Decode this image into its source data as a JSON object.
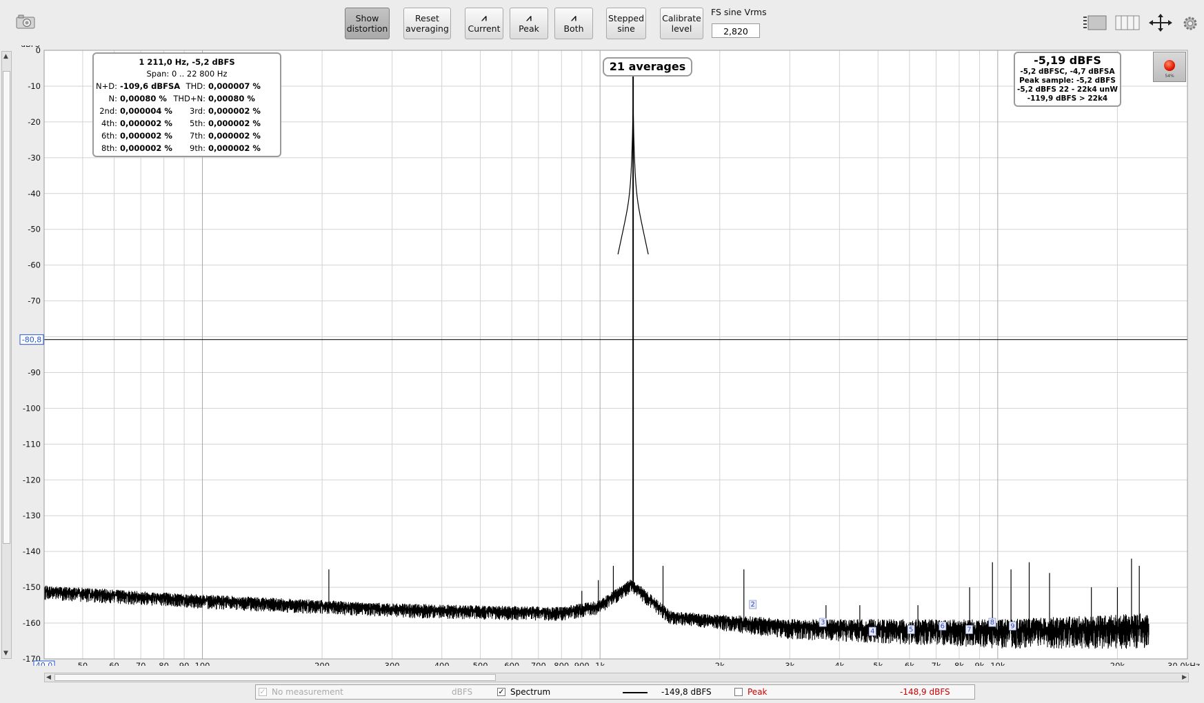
{
  "toolbar": {
    "show_distortion": "Show\ndistortion",
    "reset_averaging": "Reset\naveraging",
    "current": "Current",
    "peak": "Peak",
    "both": "Both",
    "stepped_sine": "Stepped\nsine",
    "calibrate_level": "Calibrate\nlevel",
    "fs_label": "FS sine Vrms",
    "fs_value": "2,820"
  },
  "icons": {
    "camera": "camera-icon",
    "layout": "layout-icon",
    "columns": "columns-icon",
    "move": "move-arrows-icon",
    "settings": "gear-icon",
    "record": "record-icon"
  },
  "distortion_box": {
    "line1": "1 211,0 Hz, -5,2 dBFS",
    "line2": "Span: 0 .. 22 800 Hz",
    "rows": [
      {
        "l_label": "N+D:",
        "l_val": "-109,6 dBFSA",
        "r_label": "THD:",
        "r_val": "0,000007 %"
      },
      {
        "l_label": "N:",
        "l_val": "0,00080 %",
        "r_label": "THD+N:",
        "r_val": "0,00080 %"
      },
      {
        "l_label": "2nd:",
        "l_val": "0,000004 %",
        "r_label": "3rd:",
        "r_val": "0,000002 %"
      },
      {
        "l_label": "4th:",
        "l_val": "0,000002 %",
        "r_label": "5th:",
        "r_val": "0,000002 %"
      },
      {
        "l_label": "6th:",
        "l_val": "0,000002 %",
        "r_label": "7th:",
        "r_val": "0,000002 %"
      },
      {
        "l_label": "8th:",
        "l_val": "0,000002 %",
        "r_label": "9th:",
        "r_val": "0,000002 %"
      }
    ]
  },
  "averages": "21 averages",
  "level_box": {
    "main": "-5,19 dBFS",
    "l1": "-5,2 dBFSC, -4,7 dBFSA",
    "l2": "Peak sample: -5,2 dBFS",
    "l3": "-5,2 dBFS 22 - 22k4 unW",
    "l4": "-119,9 dBFS > 22k4"
  },
  "record_meter": "54%",
  "legend": {
    "no_measurement": "No measurement",
    "dbfs": "dBFS",
    "spectrum": "Spectrum",
    "spectrum_value": "-149,8 dBFS",
    "peak": "Peak",
    "peak_value": "-148,9 dBFS"
  },
  "chart_data": {
    "type": "line",
    "ylabel": "dBFS",
    "xlabel": "",
    "x_scale": "log",
    "xlim": [
      40,
      30000
    ],
    "ylim": [
      -170,
      0
    ],
    "x_min_label": "40,0",
    "x_max_label": "30,0kHz",
    "x_ticks": [
      {
        "v": 50,
        "label": "50"
      },
      {
        "v": 60,
        "label": "60"
      },
      {
        "v": 70,
        "label": "70"
      },
      {
        "v": 80,
        "label": "80"
      },
      {
        "v": 90,
        "label": "90"
      },
      {
        "v": 100,
        "label": "100"
      },
      {
        "v": 200,
        "label": "200"
      },
      {
        "v": 300,
        "label": "300"
      },
      {
        "v": 400,
        "label": "400"
      },
      {
        "v": 500,
        "label": "500"
      },
      {
        "v": 600,
        "label": "600"
      },
      {
        "v": 700,
        "label": "700"
      },
      {
        "v": 800,
        "label": "800"
      },
      {
        "v": 900,
        "label": "900"
      },
      {
        "v": 1000,
        "label": "1k"
      },
      {
        "v": 2000,
        "label": "2k"
      },
      {
        "v": 3000,
        "label": "3k"
      },
      {
        "v": 4000,
        "label": "4k"
      },
      {
        "v": 5000,
        "label": "5k"
      },
      {
        "v": 6000,
        "label": "6k"
      },
      {
        "v": 7000,
        "label": "7k"
      },
      {
        "v": 8000,
        "label": "8k"
      },
      {
        "v": 9000,
        "label": "9k"
      },
      {
        "v": 10000,
        "label": "10k"
      },
      {
        "v": 20000,
        "label": "20k"
      }
    ],
    "y_ticks": [
      {
        "v": 0,
        "label": "0"
      },
      {
        "v": -10,
        "label": "-10"
      },
      {
        "v": -20,
        "label": "-20"
      },
      {
        "v": -30,
        "label": "-30"
      },
      {
        "v": -40,
        "label": "-40"
      },
      {
        "v": -50,
        "label": "-50"
      },
      {
        "v": -60,
        "label": "-60"
      },
      {
        "v": -70,
        "label": "-70"
      },
      {
        "v": -90,
        "label": "-90"
      },
      {
        "v": -100,
        "label": "-100"
      },
      {
        "v": -110,
        "label": "-110"
      },
      {
        "v": -120,
        "label": "-120"
      },
      {
        "v": -130,
        "label": "-130"
      },
      {
        "v": -140,
        "label": "-140"
      },
      {
        "v": -150,
        "label": "-150"
      },
      {
        "v": -160,
        "label": "-160"
      },
      {
        "v": -170,
        "label": "-170"
      }
    ],
    "cursor_level": -80.8,
    "cursor_label": "-80,8",
    "fundamental": {
      "freq": 1211,
      "level": -5.2
    },
    "noise_floor": [
      [
        40,
        -151
      ],
      [
        100,
        -153.5
      ],
      [
        300,
        -156
      ],
      [
        800,
        -157
      ],
      [
        1000,
        -155
      ],
      [
        1200,
        -149
      ],
      [
        1500,
        -158
      ],
      [
        3000,
        -161
      ],
      [
        10000,
        -162
      ],
      [
        24000,
        -161
      ]
    ],
    "spurs": [
      [
        208,
        -145
      ],
      [
        900,
        -151
      ],
      [
        990,
        -148
      ],
      [
        1080,
        -144
      ],
      [
        1440,
        -144
      ],
      [
        2300,
        -145
      ],
      [
        3700,
        -155
      ],
      [
        4500,
        -155
      ],
      [
        6300,
        -155
      ],
      [
        8500,
        -150
      ],
      [
        9700,
        -143
      ],
      [
        10800,
        -145
      ],
      [
        12000,
        -143
      ],
      [
        13500,
        -146
      ],
      [
        17200,
        -150
      ],
      [
        20000,
        -150
      ],
      [
        21700,
        -142
      ],
      [
        22700,
        -144
      ]
    ],
    "harmonics": [
      {
        "label": "2",
        "freq": 2422,
        "level": -155
      },
      {
        "label": "3",
        "freq": 3633,
        "level": -160
      },
      {
        "label": "4",
        "freq": 4844,
        "level": -162.5
      },
      {
        "label": "5",
        "freq": 6055,
        "level": -162
      },
      {
        "label": "6",
        "freq": 7266,
        "level": -161
      },
      {
        "label": "7",
        "freq": 8477,
        "level": -162
      },
      {
        "label": "8",
        "freq": 9688,
        "level": -160
      },
      {
        "label": "9",
        "freq": 10899,
        "level": -161
      }
    ]
  }
}
